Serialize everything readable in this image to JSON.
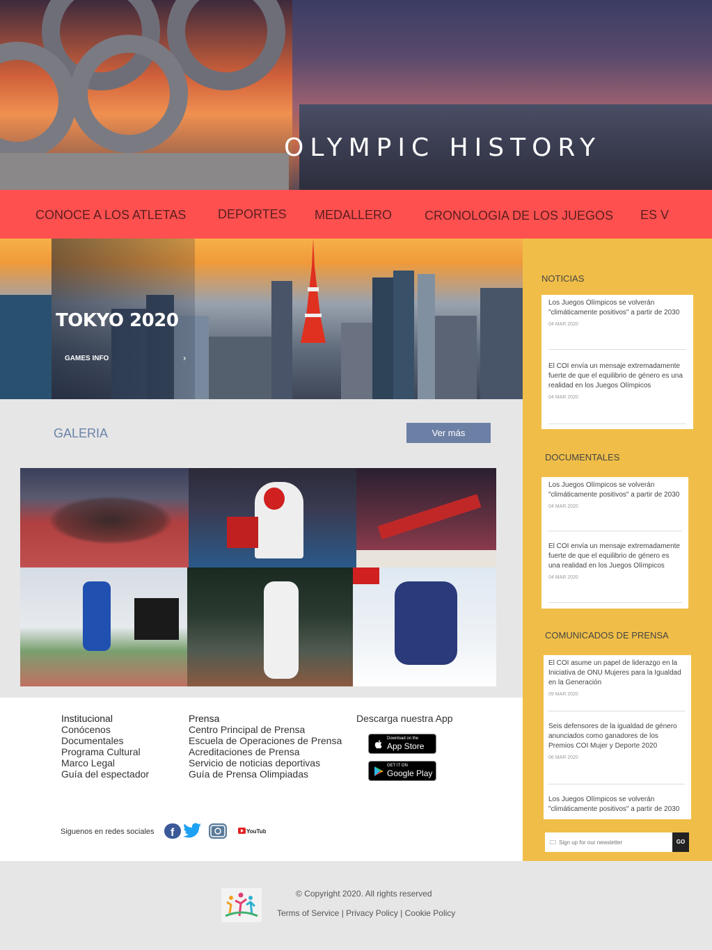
{
  "hero": {
    "title": "OLYMPIC HISTORY"
  },
  "nav": {
    "items": [
      "CONOCE A LOS ATLETAS",
      "DEPORTES",
      "MEDALLERO",
      "CRONOLOGIA DE LOS JUEGOS",
      "ES V"
    ]
  },
  "banner": {
    "title": "TOKYO 2020",
    "link": "GAMES INFO",
    "chevron": "›"
  },
  "gallery": {
    "title": "GALERIA",
    "more_button": "Ver más",
    "photos": [
      "sprint-start",
      "taekwondo",
      "gymnastics-pommel",
      "long-jump",
      "baseball",
      "alpine-ski"
    ]
  },
  "footer": {
    "col1": {
      "head": "Institucional",
      "links": [
        "Conócenos",
        "Documentales",
        "Programa Cultural",
        "Marco Legal",
        "Guía del espectador"
      ]
    },
    "col2": {
      "head": "Prensa",
      "links": [
        "Centro Principal de Prensa",
        "Escuela de Operaciones de Prensa",
        "Acreditaciones de Prensa",
        "Servicio de noticias deportivas",
        "Guía de Prensa Olimpiadas"
      ]
    },
    "app": {
      "head": "Descarga nuestra App",
      "appstore_small": "Download on the",
      "appstore_big": "App Store",
      "googleplay_small": "GET IT ON",
      "googleplay_big": "Google Play"
    },
    "social_label": "Siguenos en redes sociales",
    "youtube_label": "YouTube"
  },
  "sidebar": {
    "noticias": {
      "head": "NOTICIAS",
      "items": [
        {
          "title": "Los Juegos Olímpicos se volverán \"climáticamente positivos\" a partir de 2030",
          "date": "04 MAR 2020"
        },
        {
          "title": "El COI envía un mensaje extremadamente fuerte de que el equilibrio de género es una realidad en los Juegos Olímpicos",
          "date": "04 MAR 2020"
        }
      ]
    },
    "documentales": {
      "head": "DOCUMENTALES",
      "items": [
        {
          "title": "Los Juegos Olímpicos se volverán \"climáticamente positivos\" a partir de 2030",
          "date": "04 MAR 2020"
        },
        {
          "title": "El COI envía un mensaje extremadamente fuerte de que el equilibrio de género es una realidad en los Juegos Olímpicos",
          "date": "04 MAR 2020"
        }
      ]
    },
    "comunicados": {
      "head": "COMUNICADOS DE PRENSA",
      "items": [
        {
          "title": "El COI asume un papel de liderazgo en la Iniciativa de ONU Mujeres para la Igualdad en la Generación",
          "date": "09 MAR 2020"
        },
        {
          "title": "Seis defensores de la igualdad de género anunciados como ganadores de los Premios COI Mujer y Deporte 2020",
          "date": "06 MAR 2020"
        },
        {
          "title": "Los Juegos Olímpicos se volverán \"climáticamente positivos\" a partir de 2030"
        }
      ]
    },
    "newsletter": {
      "placeholder": "Sign up for our newsletter",
      "button": "GO"
    }
  },
  "bottom": {
    "copyright": "© Copyright 2020. All rights reserved",
    "legal": "Terms of Service | Privacy Policy | Cookie Policy"
  },
  "colors": {
    "nav": "#ff5050",
    "sidebar": "#f0be48",
    "button": "#6c7fa5"
  }
}
